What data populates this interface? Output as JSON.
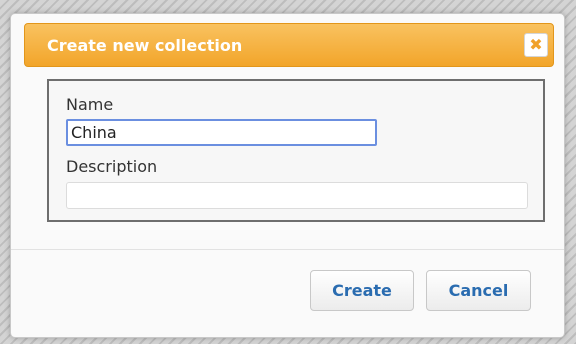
{
  "dialog": {
    "title": "Create new collection",
    "close_icon": "close-icon",
    "close_glyph": "✖"
  },
  "form": {
    "name_label": "Name",
    "name_value": "China",
    "description_label": "Description",
    "description_value": ""
  },
  "actions": {
    "create_label": "Create",
    "cancel_label": "Cancel"
  },
  "colors": {
    "title_bar": "#f2a52a",
    "button_text": "#2a6cb0",
    "focus_border": "#6b8fe0"
  }
}
